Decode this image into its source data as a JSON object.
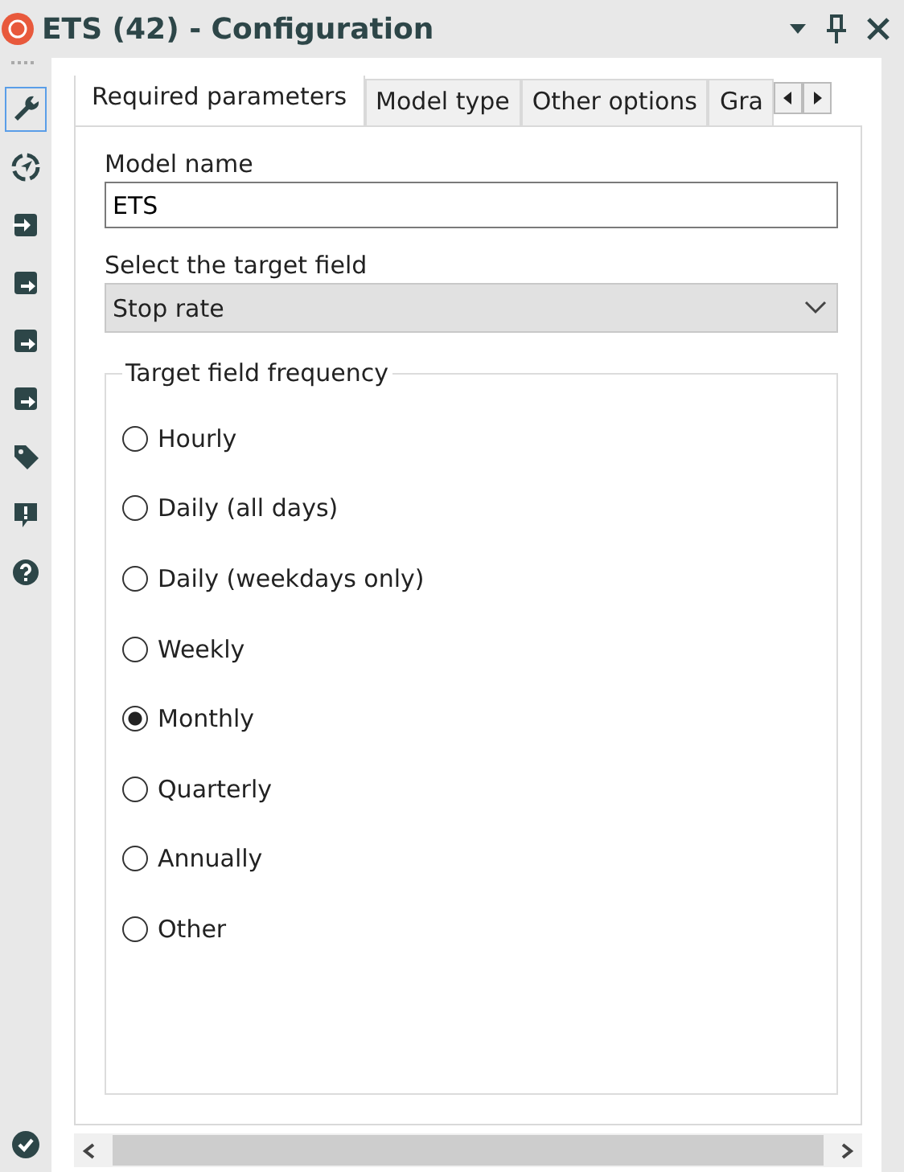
{
  "window": {
    "title": "ETS (42) - Configuration"
  },
  "sidebar": {
    "items": [
      {
        "kind": "wrench",
        "selected": true
      },
      {
        "kind": "compass",
        "selected": false
      },
      {
        "kind": "input",
        "selected": false
      },
      {
        "kind": "output",
        "selected": false
      },
      {
        "kind": "output",
        "selected": false
      },
      {
        "kind": "output",
        "selected": false
      },
      {
        "kind": "tag",
        "selected": false
      },
      {
        "kind": "alert",
        "selected": false
      },
      {
        "kind": "help",
        "selected": false
      }
    ],
    "bottom": {
      "kind": "check"
    }
  },
  "tabs": [
    {
      "label": "Required parameters",
      "selected": true
    },
    {
      "label": "Model type",
      "selected": false
    },
    {
      "label": "Other options",
      "selected": false
    },
    {
      "label": "Gra",
      "selected": false
    }
  ],
  "form": {
    "model_name": {
      "label": "Model name",
      "value": "ETS"
    },
    "target_field": {
      "label": "Select the target field",
      "value": "Stop rate"
    },
    "frequency": {
      "legend": "Target field frequency",
      "options": [
        {
          "label": "Hourly",
          "selected": false
        },
        {
          "label": "Daily (all days)",
          "selected": false
        },
        {
          "label": "Daily (weekdays only)",
          "selected": false
        },
        {
          "label": "Weekly",
          "selected": false
        },
        {
          "label": "Monthly",
          "selected": true
        },
        {
          "label": "Quarterly",
          "selected": false
        },
        {
          "label": "Annually",
          "selected": false
        },
        {
          "label": "Other",
          "selected": false
        }
      ]
    }
  }
}
